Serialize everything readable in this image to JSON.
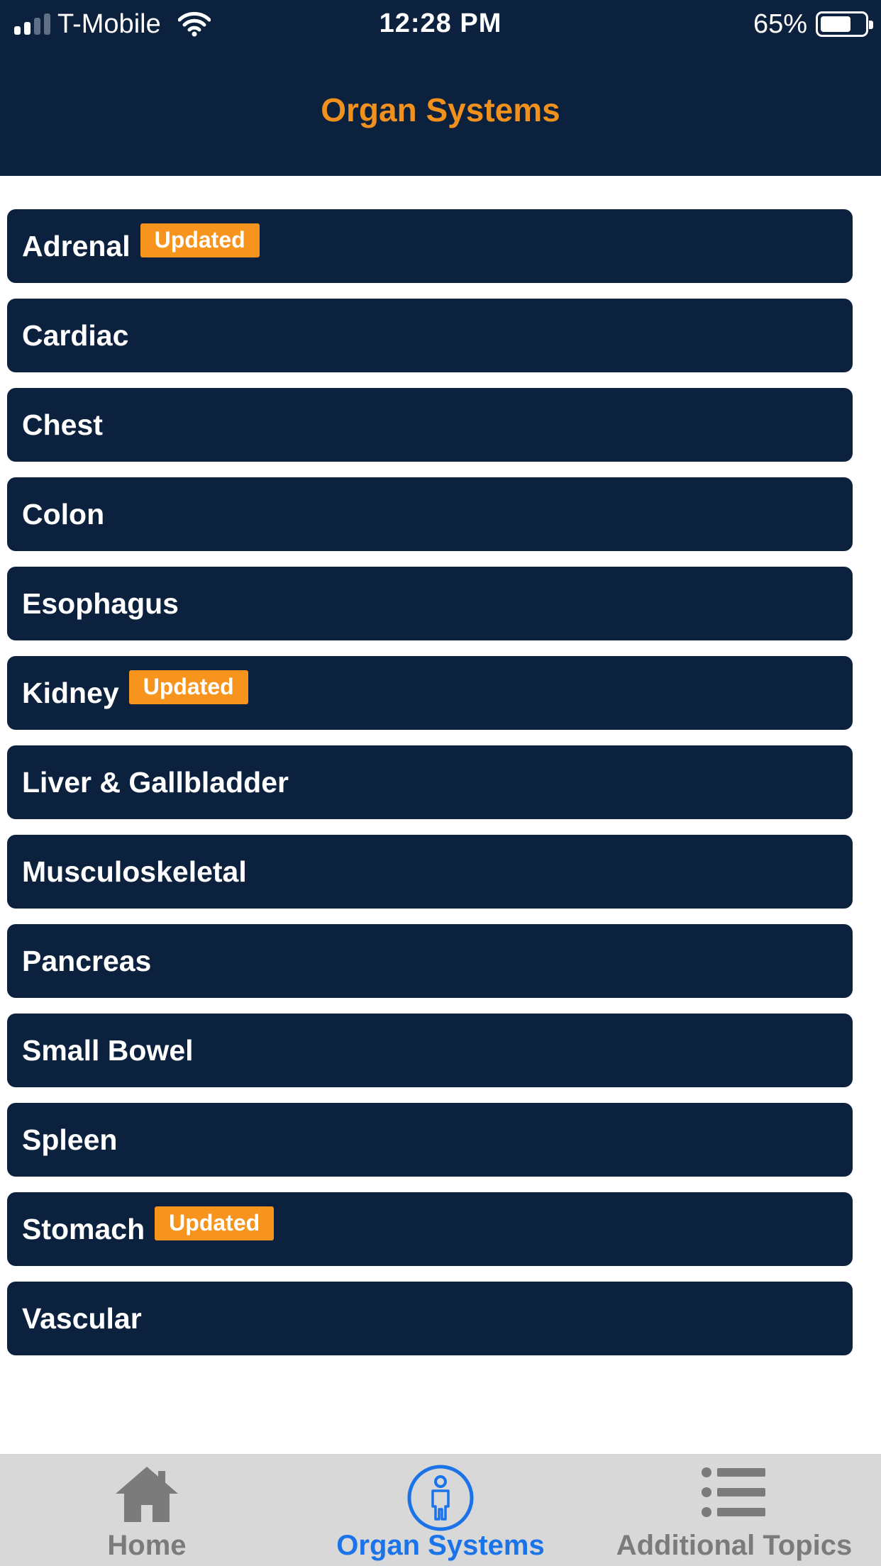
{
  "status_bar": {
    "carrier": "T-Mobile",
    "time": "12:28 PM",
    "battery_percent": "65%",
    "battery_level": 0.65,
    "signal_bars": 4,
    "signal_bars_filled": 2
  },
  "header": {
    "title": "Organ Systems"
  },
  "colors": {
    "navy": "#0c213d",
    "accent": "#f0911e",
    "badge": "#f7941d",
    "active_tab": "#1a73e8",
    "inactive_tab": "#7b7b7b",
    "tabbar_bg": "#d8d8d8"
  },
  "list": {
    "items": [
      {
        "label": "Adrenal",
        "badge": "Updated"
      },
      {
        "label": "Cardiac",
        "badge": null
      },
      {
        "label": "Chest",
        "badge": null
      },
      {
        "label": "Colon",
        "badge": null
      },
      {
        "label": "Esophagus",
        "badge": null
      },
      {
        "label": "Kidney",
        "badge": "Updated"
      },
      {
        "label": "Liver & Gallbladder",
        "badge": null
      },
      {
        "label": "Musculoskeletal",
        "badge": null
      },
      {
        "label": "Pancreas",
        "badge": null
      },
      {
        "label": "Small Bowel",
        "badge": null
      },
      {
        "label": "Spleen",
        "badge": null
      },
      {
        "label": "Stomach",
        "badge": "Updated"
      },
      {
        "label": "Vascular",
        "badge": null
      }
    ]
  },
  "tabbar": {
    "tabs": [
      {
        "label": "Home",
        "icon": "home-icon",
        "active": false
      },
      {
        "label": "Organ Systems",
        "icon": "person-icon",
        "active": true
      },
      {
        "label": "Additional Topics",
        "icon": "list-icon",
        "active": false
      }
    ]
  }
}
